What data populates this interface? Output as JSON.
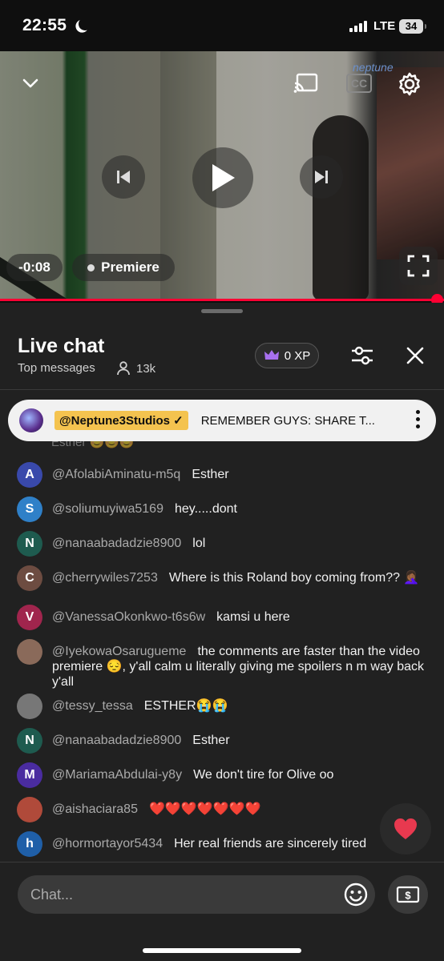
{
  "status_bar": {
    "time": "22:55",
    "network": "LTE",
    "battery": "34"
  },
  "player": {
    "watermark": "neptune",
    "time_remaining": "-0:08",
    "premiere_label": "Premiere",
    "cc_label": "CC",
    "progress": 0.98
  },
  "chat_header": {
    "title": "Live chat",
    "filter": "Top messages",
    "viewers": "13k",
    "xp": "0 XP"
  },
  "pinned": {
    "author": "@Neptune3Studios ✓",
    "text": "REMEMBER GUYS: SHARE T..."
  },
  "partial_message": "Esther 😊😊😊",
  "messages": [
    {
      "initial": "A",
      "color": "#3949ab",
      "author": "@AfolabiAminatu-m5q",
      "text": "Esther"
    },
    {
      "initial": "S",
      "color": "#2f80c8",
      "author": "@soliumuyiwa5169",
      "text": "hey.....dont"
    },
    {
      "initial": "N",
      "color": "#1e5b4f",
      "author": "@nanaabadadzie8900",
      "text": "lol"
    },
    {
      "initial": "C",
      "color": "#6d4c41",
      "author": "@cherrywiles7253",
      "text": "Where is this Roland boy coming from?? 🤦🏾‍♀️"
    },
    {
      "initial": "V",
      "color": "#a0254d",
      "author": "@VanessaOkonkwo-t6s6w",
      "text": "kamsi u here"
    },
    {
      "initial": "",
      "color": "#8a6a5a",
      "author": "@IyekowaOsarugueme",
      "text": "the comments are faster than the video premiere 😔, y'all calm u literally giving me spoilers n m way back y'all"
    },
    {
      "initial": "",
      "color": "#777777",
      "author": "@tessy_tessa",
      "text": "ESTHER😭😭"
    },
    {
      "initial": "N",
      "color": "#1e5b4f",
      "author": "@nanaabadadzie8900",
      "text": "Esther"
    },
    {
      "initial": "M",
      "color": "#4a2ca0",
      "author": "@MariamaAbdulai-y8y",
      "text": "We don't tire for Olive oo"
    },
    {
      "initial": "",
      "color": "#b04a3a",
      "author": "@aishaciara85",
      "text": "❤️❤️❤️❤️❤️❤️❤️"
    },
    {
      "initial": "h",
      "color": "#1f5fa8",
      "author": "@hormortayor5434",
      "text": "Her real friends are sincerely tired"
    }
  ],
  "composer": {
    "placeholder": "Chat..."
  }
}
